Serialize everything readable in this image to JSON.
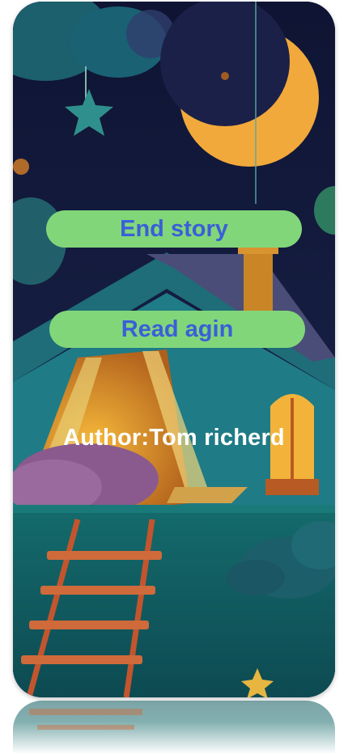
{
  "buttons": {
    "end_story": "End story",
    "read_again": "Read agin"
  },
  "author": {
    "label": "Author:Tom richerd"
  },
  "colors": {
    "button_bg": "#82d67a",
    "button_text": "#3a5fd8",
    "author_text": "#ffffff"
  }
}
